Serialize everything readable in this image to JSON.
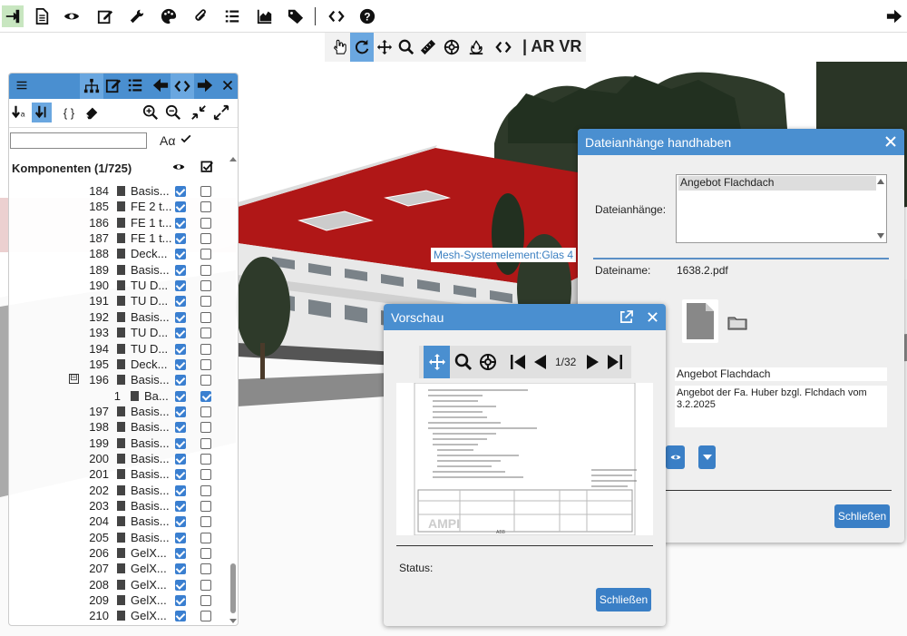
{
  "toolbar": {
    "icons": [
      "login-icon",
      "document-icon",
      "eye-icon",
      "edit-icon",
      "wrench-icon",
      "palette-icon",
      "paperclip-icon",
      "list-icon",
      "area-chart-icon",
      "tag-icon",
      "code-icon",
      "help-icon",
      "arrow-right-icon"
    ]
  },
  "viewbar": {
    "icons": [
      "hand-icon",
      "rotate-icon",
      "move-icon",
      "zoom-icon",
      "measure-icon",
      "target-icon",
      "fire-icon",
      "code-icon"
    ],
    "ar_vr_label": "| AR VR"
  },
  "scene": {
    "tooltip": "Mesh-Systemelement:Glas 4"
  },
  "components": {
    "title": "Komponenten (1/725)",
    "rows": [
      {
        "num": "184",
        "name": "Basis..."
      },
      {
        "num": "185",
        "name": "FE 2 t..."
      },
      {
        "num": "186",
        "name": "FE 1 t..."
      },
      {
        "num": "187",
        "name": "FE 1 t..."
      },
      {
        "num": "188",
        "name": "Deck..."
      },
      {
        "num": "189",
        "name": "Basis..."
      },
      {
        "num": "190",
        "name": "TU D..."
      },
      {
        "num": "191",
        "name": "TU D..."
      },
      {
        "num": "192",
        "name": "Basis..."
      },
      {
        "num": "193",
        "name": "TU D..."
      },
      {
        "num": "194",
        "name": "TU D..."
      },
      {
        "num": "195",
        "name": "Deck..."
      },
      {
        "num": "196",
        "name": "Basis...",
        "toggle": "⊟"
      },
      {
        "num": "1",
        "name": "Ba...",
        "child": true
      },
      {
        "num": "197",
        "name": "Basis..."
      },
      {
        "num": "198",
        "name": "Basis..."
      },
      {
        "num": "199",
        "name": "Basis..."
      },
      {
        "num": "200",
        "name": "Basis..."
      },
      {
        "num": "201",
        "name": "Basis..."
      },
      {
        "num": "202",
        "name": "Basis..."
      },
      {
        "num": "203",
        "name": "Basis..."
      },
      {
        "num": "204",
        "name": "Basis..."
      },
      {
        "num": "205",
        "name": "Basis..."
      },
      {
        "num": "206",
        "name": "GelX..."
      },
      {
        "num": "207",
        "name": "GelX..."
      },
      {
        "num": "208",
        "name": "GelX..."
      },
      {
        "num": "209",
        "name": "GelX..."
      },
      {
        "num": "210",
        "name": "GelX..."
      }
    ],
    "search_value": "",
    "case_label": "Aα",
    "braces_label": "{ }"
  },
  "attachments": {
    "title": "Dateianhänge handhaben",
    "label_files": "Dateianhänge:",
    "selected_file": "Angebot Flachdach",
    "label_filename": "Dateiname:",
    "filename": "1638.2.pdf",
    "file_title": "Angebot Flachdach",
    "description": "Angebot der Fa. Huber bzgl. Flchdach vom 3.2.2025",
    "close_button": "Schließen"
  },
  "preview": {
    "title": "Vorschau",
    "page_indicator": "1/32",
    "status_label": "Status:",
    "close_button": "Schließen"
  }
}
